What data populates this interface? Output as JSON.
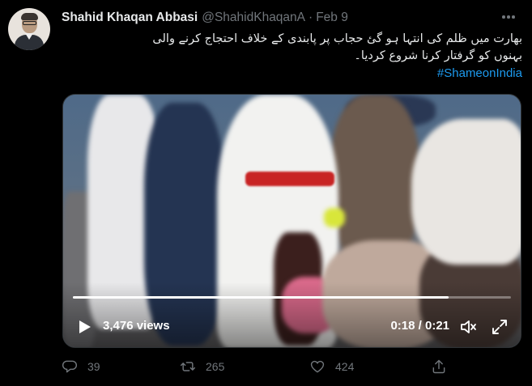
{
  "tweet": {
    "author_name": "Shahid Khaqan Abbasi",
    "author_handle": "@ShahidKhaqanA",
    "separator": "·",
    "date": "Feb 9",
    "body_lines": [
      "بھارت میں ظلم کی انتہا ہو گئ حجاب پر پابندی کے خلاف احتجاج کرنے والی",
      "بہنوں کو گرفتار کرنا شروع کردیا۔"
    ],
    "hashtag": "#ShameonIndia"
  },
  "video": {
    "views": "3,476 views",
    "time": "0:18 / 0:21",
    "progress": 0.857
  },
  "actions": {
    "replies": "39",
    "retweets": "265",
    "likes": "424"
  },
  "colors": {
    "background": "#000000",
    "text_primary": "#e7e9ea",
    "text_secondary": "#71767b",
    "link": "#1d9bf0"
  },
  "icons": [
    "more-options-icon",
    "play-icon",
    "volume-icon",
    "fullscreen-icon",
    "reply-icon",
    "retweet-icon",
    "like-icon",
    "share-icon"
  ]
}
